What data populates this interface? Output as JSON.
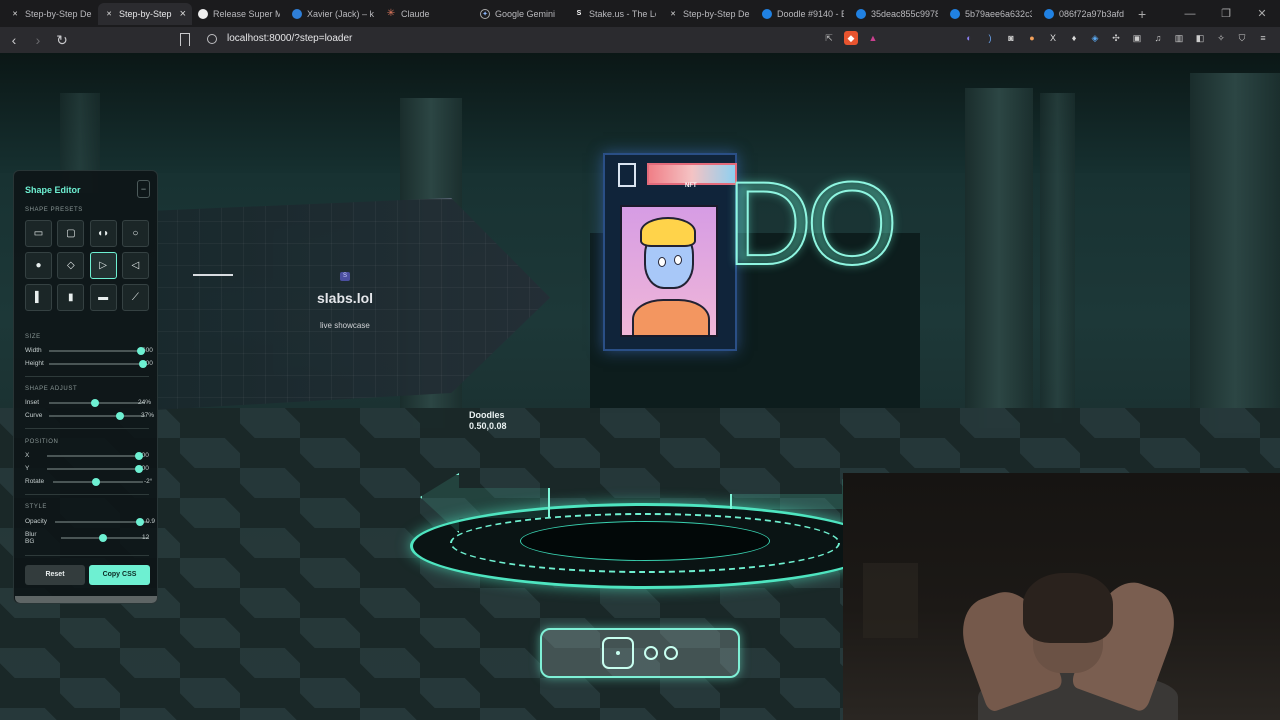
{
  "browser": {
    "tabs": [
      {
        "title": "Step-by-Step De",
        "icon": "tool-icon",
        "active": false
      },
      {
        "title": "Step-by-Step",
        "icon": "tool-icon",
        "active": true
      },
      {
        "title": "Release Super M",
        "icon": "github-icon",
        "active": false
      },
      {
        "title": "Xavier (Jack) – k",
        "icon": "globe-icon",
        "active": false
      },
      {
        "title": "Claude",
        "icon": "claude-icon",
        "active": false
      },
      {
        "title": "Google Gemini",
        "icon": "gemini-icon",
        "active": false
      },
      {
        "title": "Stake.us - The Le",
        "icon": "stake-icon",
        "active": false
      },
      {
        "title": "Step-by-Step De",
        "icon": "tool-icon",
        "active": false
      },
      {
        "title": "Doodle #9140 - E",
        "icon": "opensea-icon",
        "active": false
      },
      {
        "title": "35deac855c9978",
        "icon": "opensea-icon",
        "active": false
      },
      {
        "title": "5b79aee6a632c3",
        "icon": "opensea-icon",
        "active": false
      },
      {
        "title": "086f72a97b3afd",
        "icon": "opensea-icon",
        "active": false
      }
    ],
    "url": "localhost:8000/?step=loader"
  },
  "scene": {
    "card_title": "slabs.lol",
    "card_subtitle": "live showcase",
    "card_badge": "S",
    "nft_label": "NFT",
    "neon_text": "DO",
    "doodles_name": "Doodles",
    "doodles_coords": "0.50,0.08",
    "pager": {
      "pages": 3,
      "active_index": 0
    }
  },
  "editor": {
    "title": "Shape Editor",
    "collapse_label": "−",
    "sections": {
      "presets": "SHAPE PRESETS",
      "size": "SIZE",
      "adjust": "SHAPE ADJUST",
      "position": "POSITION",
      "style": "STYLE"
    },
    "presets": [
      {
        "name": "rectangle",
        "glyph": "▭"
      },
      {
        "name": "rounded-rectangle",
        "glyph": "▢"
      },
      {
        "name": "pill",
        "glyph": "◖◗"
      },
      {
        "name": "circle",
        "glyph": "○"
      },
      {
        "name": "filled-circle",
        "glyph": "●"
      },
      {
        "name": "diamond",
        "glyph": "◇"
      },
      {
        "name": "arrow-right",
        "glyph": "▷"
      },
      {
        "name": "arrow-left",
        "glyph": "◁"
      },
      {
        "name": "tall-bar",
        "glyph": "▌"
      },
      {
        "name": "tall-box",
        "glyph": "▮"
      },
      {
        "name": "card",
        "glyph": "▬"
      },
      {
        "name": "slash",
        "glyph": "⟋"
      }
    ],
    "selected_preset": 6,
    "controls": {
      "width": {
        "label": "Width",
        "value": "600",
        "fraction": 0.98
      },
      "height": {
        "label": "Height",
        "value": "300",
        "fraction": 1.0
      },
      "inset": {
        "label": "Inset",
        "value": "24%",
        "fraction": 0.48
      },
      "curve": {
        "label": "Curve",
        "value": "37%",
        "fraction": 0.74
      },
      "x": {
        "label": "X",
        "value": "200",
        "fraction": 1.0
      },
      "y": {
        "label": "Y",
        "value": "200",
        "fraction": 1.0
      },
      "rotate": {
        "label": "Rotate",
        "value": "-2°",
        "fraction": 0.48
      },
      "opacity": {
        "label": "Opacity",
        "value": "0.9",
        "fraction": 0.9
      },
      "blur": {
        "label": "Blur BG",
        "value": "12",
        "fraction": 0.48
      }
    },
    "reset_label": "Reset",
    "copy_label": "Copy CSS"
  },
  "colors": {
    "accent": "#6ef0d2",
    "neon": "#8ff5e0"
  }
}
